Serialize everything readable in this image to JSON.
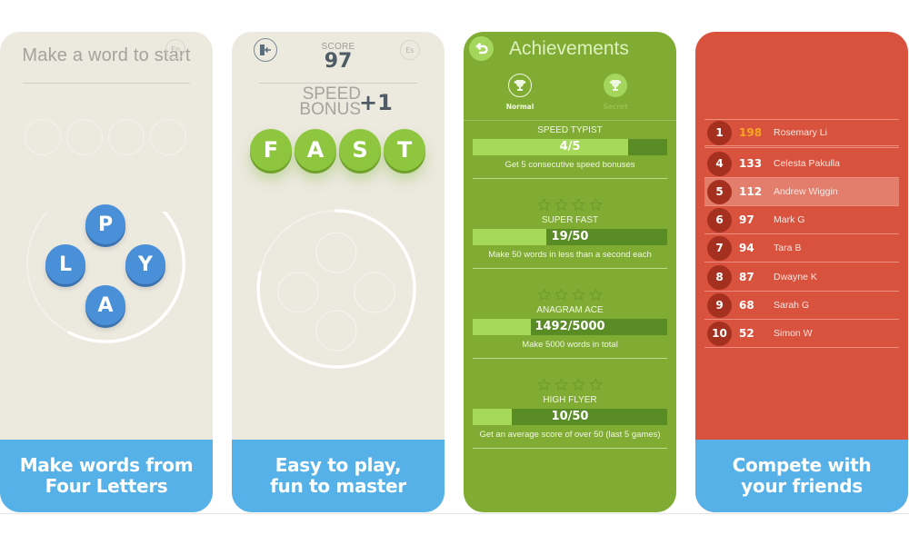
{
  "colors": {
    "card_beige": "#ece9df",
    "card_green": "#80ac34",
    "card_red": "#d9523d",
    "caption_blue": "#55b1e8",
    "tile_blue": "#4a90d9",
    "tile_green": "#8ec63f",
    "gold_score": "#f7a623"
  },
  "screens": [
    {
      "title": "Make a word to start",
      "language_badge": "En",
      "letter_tiles": [
        "P",
        "L",
        "Y",
        "A"
      ],
      "caption": "Make words from\nFour Letters"
    },
    {
      "exit_icon": "exit-door-icon",
      "score_label": "SCORE",
      "score_value": "97",
      "language_badge": "Es",
      "bonus_line1": "SPEED",
      "bonus_line2": "BONUS",
      "bonus_value": "+1",
      "word_tiles": [
        "F",
        "A",
        "S",
        "T"
      ],
      "caption": "Easy to play,\nfun to master"
    },
    {
      "back_icon": "back-arrow-icon",
      "title": "Achievements",
      "tabs": [
        {
          "label": "Normal",
          "icon": "trophy-icon",
          "active": true
        },
        {
          "label": "Secret",
          "icon": "trophy-icon",
          "active": false
        }
      ],
      "achievements": [
        {
          "name": "SPEED TYPIST",
          "progress_text": "4/5",
          "progress": 0.8,
          "description": "Get 5 consecutive speed bonuses",
          "show_stars": false
        },
        {
          "name": "SUPER FAST",
          "progress_text": "19/50",
          "progress": 0.38,
          "description": "Make 50 words in less than a second each",
          "show_stars": true,
          "stars": 0
        },
        {
          "name": "ANAGRAM ACE",
          "progress_text": "1492/5000",
          "progress": 0.298,
          "description": "Make 5000 words in total",
          "show_stars": true,
          "stars": 0
        },
        {
          "name": "HIGH FLYER",
          "progress_text": "10/50",
          "progress": 0.2,
          "description": "Get an average score of over 50 (last 5 games)",
          "show_stars": true,
          "stars": 0
        }
      ]
    },
    {
      "leaderboard": [
        {
          "rank": "1",
          "score": "198",
          "name": "Rosemary Li",
          "highlight": false,
          "gold": true
        },
        {
          "rank": "4",
          "score": "133",
          "name": "Celesta Pakulla",
          "highlight": false,
          "gold": false
        },
        {
          "rank": "5",
          "score": "112",
          "name": "Andrew Wiggin",
          "highlight": true,
          "gold": false
        },
        {
          "rank": "6",
          "score": "97",
          "name": "Mark G",
          "highlight": false,
          "gold": false
        },
        {
          "rank": "7",
          "score": "94",
          "name": "Tara B",
          "highlight": false,
          "gold": false
        },
        {
          "rank": "8",
          "score": "87",
          "name": "Dwayne K",
          "highlight": false,
          "gold": false
        },
        {
          "rank": "9",
          "score": "68",
          "name": "Sarah G",
          "highlight": false,
          "gold": false
        },
        {
          "rank": "10",
          "score": "52",
          "name": "Simon W",
          "highlight": false,
          "gold": false
        }
      ],
      "caption": "Compete with\nyour friends"
    }
  ]
}
